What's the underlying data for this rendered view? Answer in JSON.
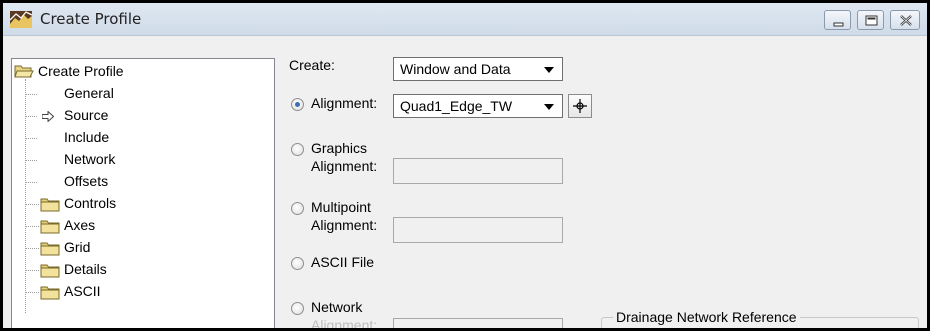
{
  "window": {
    "title": "Create Profile",
    "controls": [
      "minimize",
      "maximize",
      "close"
    ]
  },
  "tree": {
    "root_label": "Create Profile",
    "items": [
      {
        "label": "General",
        "type": "leaf"
      },
      {
        "label": "Source",
        "type": "leaf-selected"
      },
      {
        "label": "Include",
        "type": "leaf"
      },
      {
        "label": "Network",
        "type": "leaf"
      },
      {
        "label": "Offsets",
        "type": "leaf"
      },
      {
        "label": "Controls",
        "type": "folder"
      },
      {
        "label": "Axes",
        "type": "folder"
      },
      {
        "label": "Grid",
        "type": "folder"
      },
      {
        "label": "Details",
        "type": "folder"
      },
      {
        "label": "ASCII",
        "type": "folder"
      }
    ]
  },
  "form": {
    "create_label": "Create:",
    "create_value": "Window and Data",
    "alignment_radio": "Alignment:",
    "alignment_value": "Quad1_Edge_TW",
    "graphics_line1": "Graphics",
    "graphics_line2": "Alignment:",
    "multipoint_line1": "Multipoint",
    "multipoint_line2": "Alignment:",
    "ascii_file": "ASCII File",
    "network_line1": "Network",
    "network_line2": "Alignment:",
    "drainage_group_title": "Drainage Network Reference",
    "selected_source": "Alignment"
  },
  "icons": {
    "app": "profile-app-icon",
    "tree_root": "open-folder-icon",
    "tree_selected": "arrow-right-icon",
    "folder": "folder-icon",
    "pick": "crosshair-icon"
  }
}
